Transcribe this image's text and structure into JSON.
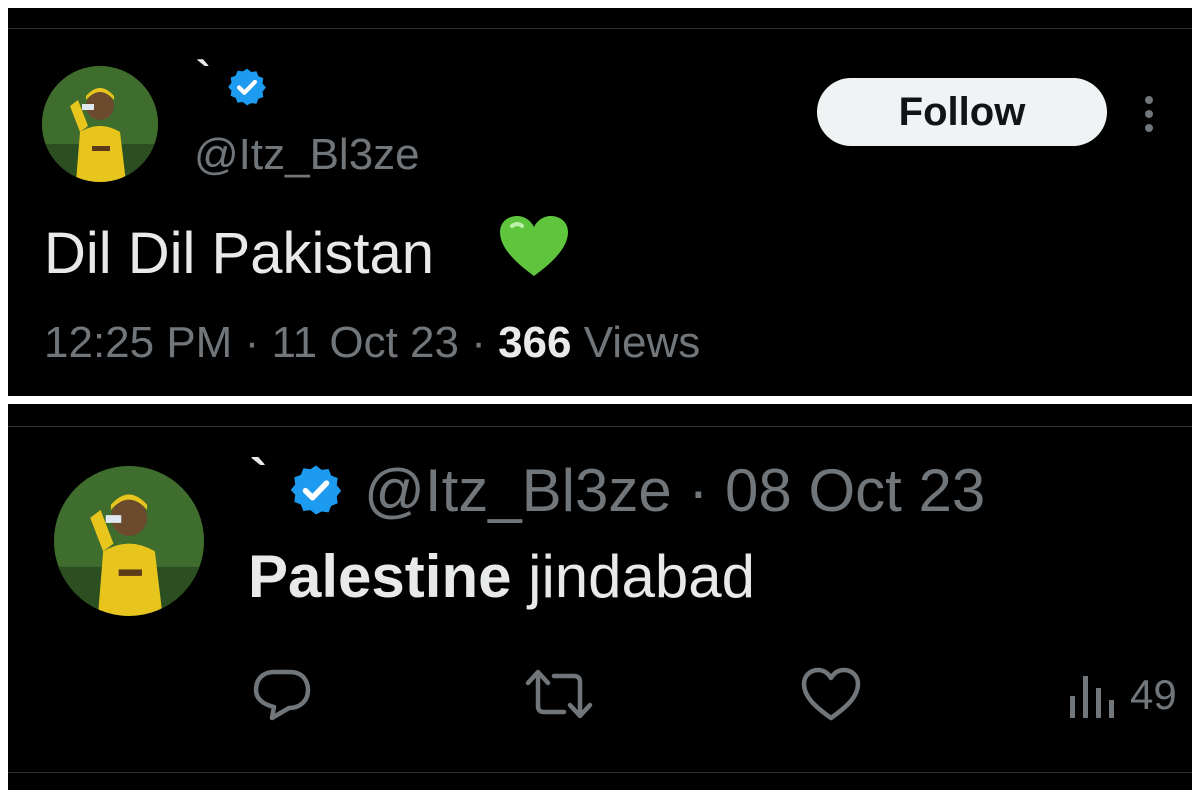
{
  "top_tweet": {
    "display_name": "`",
    "handle": "@Itz_Bl3ze",
    "follow_label": "Follow",
    "text": "Dil Dil Pakistan",
    "emoji": "green-heart",
    "time": "12:25 PM",
    "sep1": " · ",
    "date": "11 Oct 23",
    "sep2": " · ",
    "views_count": "366",
    "views_label": " Views"
  },
  "bottom_tweet": {
    "display_name": "`",
    "handle": "@Itz_Bl3ze",
    "date_sep": " · ",
    "date": "08 Oct 23",
    "text_bold": "Palestine",
    "text_rest": " jindabad",
    "views_count": "49",
    "actions": [
      "reply-icon",
      "retweet-icon",
      "like-icon",
      "views-icon"
    ]
  },
  "colors": {
    "background": "#000000",
    "text_primary": "#e7e9ea",
    "text_secondary": "#71767b",
    "verified": "#1d9bf0",
    "follow_bg": "#eff3f4",
    "emoji_green": "#5ec53d"
  }
}
